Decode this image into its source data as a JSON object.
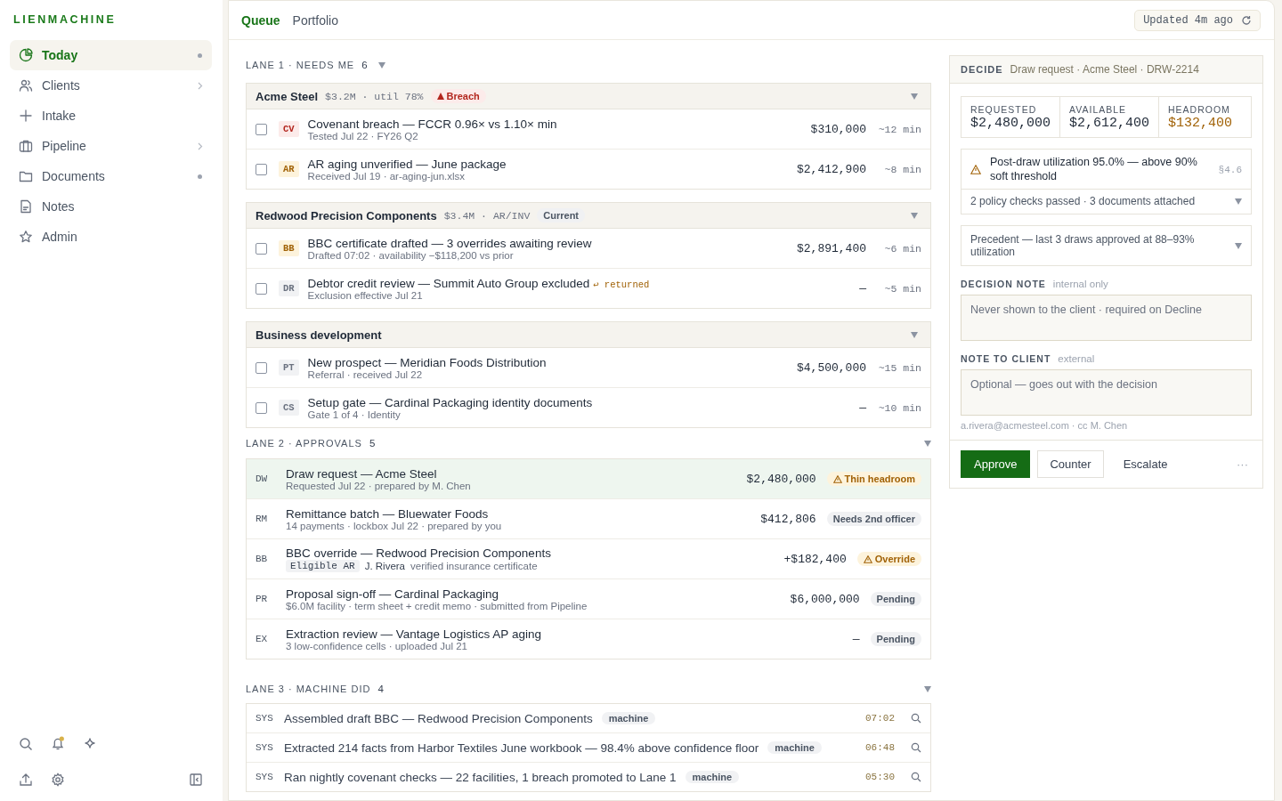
{
  "sidebar": {
    "brand": "LIENMACHINE",
    "notifications_unread": true,
    "items": [
      {
        "label": "Today",
        "selected": true,
        "dot": true,
        "chevron": false
      },
      {
        "label": "Clients",
        "selected": false,
        "dot": false,
        "chevron": true
      },
      {
        "label": "Intake",
        "selected": false,
        "dot": false,
        "chevron": false
      },
      {
        "label": "Pipeline",
        "selected": false,
        "dot": false,
        "chevron": true
      },
      {
        "label": "Documents",
        "selected": false,
        "dot": true,
        "chevron": false
      },
      {
        "label": "Notes",
        "selected": false,
        "dot": false,
        "chevron": false
      },
      {
        "label": "Admin",
        "selected": false,
        "dot": false,
        "chevron": false
      }
    ]
  },
  "tabs": [
    {
      "label": "Queue",
      "selected": true
    },
    {
      "label": "Portfolio",
      "selected": false
    }
  ],
  "updated": "Updated 4m ago",
  "lane1": {
    "title": "LANE 1 · NEEDS ME",
    "count": "6",
    "groups": [
      {
        "name": "Acme Steel",
        "meta": "$3.2M · util 78%",
        "badge": {
          "text": "Breach",
          "kind": "danger"
        },
        "items": [
          {
            "code": "CV",
            "kind": "danger",
            "checked": false,
            "title": "Covenant breach — FCCR 0.96× vs 1.10× min",
            "subtitle": "Tested Jul 22 · FY26 Q2",
            "amount": "$310,000",
            "eta": "~12 min"
          },
          {
            "code": "AR",
            "kind": "warn",
            "checked": false,
            "title": "AR aging unverified — June package",
            "subtitle": "Received Jul 19 · ar-aging-jun.xlsx",
            "amount": "$2,412,900",
            "eta": "~8 min"
          }
        ]
      },
      {
        "name": "Redwood Precision Components",
        "meta": "$3.4M · AR/INV",
        "badge": {
          "text": "Current",
          "kind": "neutral"
        },
        "items": [
          {
            "code": "BB",
            "kind": "warn",
            "checked": false,
            "title": "BBC certificate drafted — 3 overrides awaiting review",
            "subtitle": "Drafted 07:02 · availability −$118,200 vs prior",
            "amount": "$2,891,400",
            "eta": "~6 min"
          },
          {
            "code": "DR",
            "kind": "neutral",
            "checked": false,
            "title": "Debtor credit review — Summit Auto Group excluded",
            "flag": "↩ returned",
            "subtitle": "Exclusion effective Jul 21",
            "amount": "—",
            "eta": "~5 min"
          }
        ]
      },
      {
        "name": "Business development",
        "items": [
          {
            "code": "PT",
            "kind": "neutral",
            "checked": false,
            "title": "New prospect — Meridian Foods Distribution",
            "subtitle": "Referral · received Jul 22",
            "amount": "$4,500,000",
            "eta": "~15 min"
          },
          {
            "code": "CS",
            "kind": "neutral",
            "checked": false,
            "title": "Setup gate — Cardinal Packaging identity documents",
            "subtitle": "Gate 1 of 4 · Identity",
            "amount": "—",
            "eta": "~10 min"
          }
        ]
      }
    ]
  },
  "lane2": {
    "title": "LANE 2 · APPROVALS",
    "count": "5",
    "items": [
      {
        "code": "DW",
        "selected": true,
        "title": "Draw request — Acme Steel",
        "subtitle": "Requested Jul 22 · prepared by M. Chen",
        "amount": "$2,480,000",
        "status": {
          "text": "Thin headroom",
          "kind": "warn"
        }
      },
      {
        "code": "RM",
        "selected": false,
        "title": "Remittance batch — Bluewater Foods",
        "subtitle": "14 payments · lockbox Jul 22 · prepared by you",
        "amount": "$412,806",
        "status": {
          "text": "Needs 2nd officer",
          "kind": "neutral"
        }
      },
      {
        "code": "BB",
        "selected": false,
        "title": "BBC override — Redwood Precision Components",
        "chip": "Eligible AR",
        "by": "J. Rivera",
        "subtitle": "verified insurance certificate",
        "amount": "+$182,400",
        "status": {
          "text": "Override",
          "kind": "warn"
        }
      },
      {
        "code": "PR",
        "selected": false,
        "title": "Proposal sign-off — Cardinal Packaging",
        "subtitle": "$6.0M facility · term sheet + credit memo · submitted from Pipeline",
        "amount": "$6,000,000",
        "status": {
          "text": "Pending",
          "kind": "neutral"
        }
      },
      {
        "code": "EX",
        "selected": false,
        "title": "Extraction review — Vantage Logistics AP aging",
        "subtitle": "3 low-confidence cells · uploaded Jul 21",
        "amount": "—",
        "status": {
          "text": "Pending",
          "kind": "neutral"
        }
      }
    ]
  },
  "lane3": {
    "title": "LANE 3 · MACHINE DID",
    "count": "4",
    "items": [
      {
        "code": "SYS",
        "text": "Assembled draft BBC — Redwood Precision Components",
        "tag": "machine",
        "time": "07:02"
      },
      {
        "code": "SYS",
        "text": "Extracted 214 facts from Harbor Textiles June workbook — 98.4% above confidence floor",
        "tag": "machine",
        "time": "06:48"
      },
      {
        "code": "SYS",
        "text": "Ran nightly covenant checks — 22 facilities, 1 breach promoted to Lane 1",
        "tag": "machine",
        "time": "05:30"
      }
    ]
  },
  "decide": {
    "label": "DECIDE",
    "context": "Draw request · Acme Steel · DRW-2214",
    "metrics": [
      {
        "label": "REQUESTED",
        "value": "$2,480,000",
        "kind": "normal"
      },
      {
        "label": "AVAILABLE",
        "value": "$2,612,400",
        "kind": "normal"
      },
      {
        "label": "HEADROOM",
        "value": "$132,400",
        "kind": "warn"
      }
    ],
    "alert": {
      "text": "Post-draw utilization 95.0% — above 90% soft threshold",
      "ref": "§4.6"
    },
    "checks": "2 policy checks passed · 3 documents attached",
    "precedent": "Precedent — last 3 draws approved at 88–93% utilization",
    "decision_note": {
      "label": "DECISION NOTE",
      "hint": "internal only",
      "placeholder": "Never shown to the client · required on Decline"
    },
    "client_note": {
      "label": "NOTE TO CLIENT",
      "hint": "external",
      "placeholder": "Optional — goes out with the decision",
      "recipients": "a.rivera@acmesteel.com · cc M. Chen"
    },
    "buttons": [
      {
        "label": "Approve",
        "kind": "primary"
      },
      {
        "label": "Counter",
        "kind": "outline"
      },
      {
        "label": "Escalate",
        "kind": "plain"
      },
      {
        "label": "···",
        "kind": "more"
      }
    ]
  }
}
